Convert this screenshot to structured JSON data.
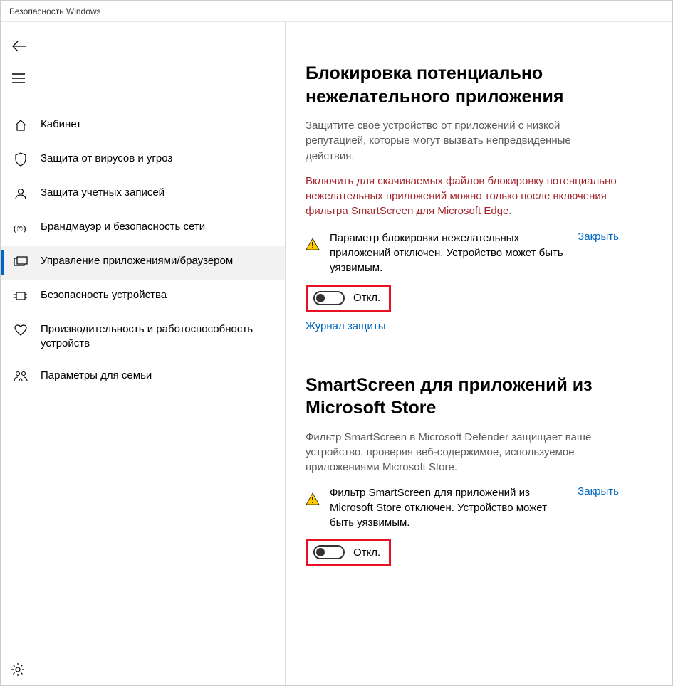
{
  "window": {
    "title": "Безопасность Windows"
  },
  "sidebar": {
    "items": [
      {
        "label": "Кабинет"
      },
      {
        "label": "Защита от вирусов и угроз"
      },
      {
        "label": "Защита учетных записей"
      },
      {
        "label": "Брандмауэр и безопасность сети"
      },
      {
        "label": "Управление приложениями/браузером"
      },
      {
        "label": "Безопасность устройства"
      },
      {
        "label": "Производительность и работоспособность устройств"
      },
      {
        "label": "Параметры для семьи"
      }
    ]
  },
  "sections": {
    "pua": {
      "heading": "Блокировка потенциально нежелательного приложения",
      "desc": "Защитите свое устройство от приложений с низкой репутацией, которые могут вызвать непредвиденные действия.",
      "warning": "Включить для скачиваемых файлов блокировку потенциально нежелательных приложений можно только после включения фильтра SmartScreen для Microsoft Edge.",
      "alert": "Параметр блокировки нежелательных приложений отключен. Устройство может быть уязвимым.",
      "dismiss": "Закрыть",
      "toggle_label": "Откл.",
      "history_link": "Журнал защиты"
    },
    "smartscreen": {
      "heading": "SmartScreen для приложений из Microsoft Store",
      "desc": "Фильтр SmartScreen в Microsoft Defender защищает ваше устройство, проверяя веб-содержимое, используемое приложениями Microsoft Store.",
      "alert": "Фильтр SmartScreen для приложений из Microsoft Store отключен. Устройство может быть уязвимым.",
      "dismiss": "Закрыть",
      "toggle_label": "Откл."
    }
  }
}
